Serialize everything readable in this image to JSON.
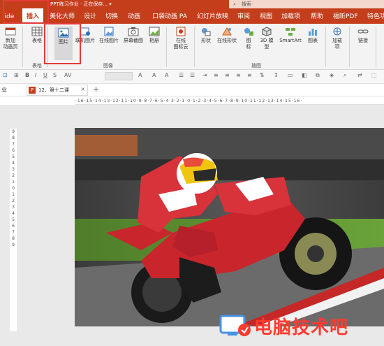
{
  "titlebar": {
    "doc_title": "PPT练习作业 · 正在保存... ▾",
    "search_placeholder": "搜索"
  },
  "tabs": [
    {
      "label": "lide"
    },
    {
      "label": "插入"
    },
    {
      "label": "美化大师"
    },
    {
      "label": "设计"
    },
    {
      "label": "切换"
    },
    {
      "label": "动画"
    },
    {
      "label": "口袋动画 PA"
    },
    {
      "label": "幻灯片放映"
    },
    {
      "label": "审阅"
    },
    {
      "label": "视图"
    },
    {
      "label": "加载项"
    },
    {
      "label": "帮助"
    },
    {
      "label": "福昕PDF"
    },
    {
      "label": "特色功能"
    }
  ],
  "ribbon": {
    "new_slide": "新加\n动画页",
    "table": "表格",
    "picture": "图片",
    "online_picture": "联机图片",
    "online_image": "在线图片",
    "screenshot": "屏幕截图",
    "album": "相册",
    "online_icons": "在线\n图标云",
    "shapes": "形状",
    "online_shapes": "在线形状",
    "icons": "图\n标",
    "model3d": "3D 模\n型",
    "smartart": "SmartArt",
    "chart": "图表",
    "addins": "加载\n项",
    "link": "链接",
    "group_table": "表格",
    "group_image": "图像",
    "group_illustration": "插图"
  },
  "docbar": {
    "label": "业",
    "tab_name": "12、第十二课",
    "close": "×",
    "new_tab": "+"
  },
  "hruler_text": "·16·15·14·13·12·11·10·9·8·7·6·5·4·3·2·1·0·1·2·3·4·5·6·7·8·9·10·11·12·13·14·15·16·",
  "vruler_marks": [
    "9",
    "8",
    "7",
    "6",
    "5",
    "4",
    "3",
    "2",
    "1",
    "0",
    "1",
    "2",
    "3",
    "4",
    "5",
    "6",
    "7",
    "8",
    "9"
  ],
  "watermark": "电脑技术吧",
  "colors": {
    "accent": "#c43e1c",
    "highlight": "#e53a3a"
  }
}
